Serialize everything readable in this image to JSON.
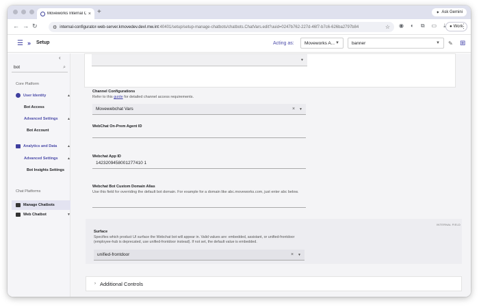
{
  "browser": {
    "tab_title": "Moveworks Internal Configura",
    "new_tab_label": "+",
    "gemini_label": "Ask Gemini",
    "url_host": "internal-configurator-web-server.kmovedev.devl.mw.int",
    "url_path": ":40401/setup/setup-manage-chatbots/chatbots.ChatVars.edit?uuid=0247b762-227d-46f7-b7c6-626ba2797b84",
    "profile_label": "Work"
  },
  "header": {
    "title": "Setup",
    "acting_as_label": "Acting as:",
    "acting_as_value": "Moveworks A...",
    "org_value": "banner"
  },
  "sidebar": {
    "collapse_label": "‹",
    "search_value": "bot",
    "sections": [
      "Core Platform",
      "Chat Platforms"
    ],
    "items": [
      {
        "label": "User Identity"
      },
      {
        "label": "Bot Access"
      },
      {
        "label": "Advanced Settings"
      },
      {
        "label": "Bot Account"
      },
      {
        "label": "Analytics and Data"
      },
      {
        "label": "Advanced Settings"
      },
      {
        "label": "Bot Insights Settings"
      },
      {
        "label": "Manage Chatbots"
      },
      {
        "label": "Web Chatbot"
      }
    ]
  },
  "main": {
    "channel_configurations": {
      "label": "Channel Configurations",
      "help_prefix": "Refer to this",
      "help_link": "guide",
      "help_suffix": "for detailed channel access requirements.",
      "value": "Movewebchat Vars"
    },
    "onprem_agent_id": {
      "label": "WebChat On-Prem Agent ID",
      "value": ""
    },
    "webchat_app_id": {
      "label": "Webchat App ID",
      "value": "1423209458001277410 1"
    },
    "custom_domain_alias": {
      "label": "Webchat Bot Custom Domain Alias",
      "help": "Use this field for overriding the default bot domain. For example for a domain like abc.moveworks.com, just enter abc below.",
      "value": ""
    },
    "surface": {
      "tag": "INTERNAL FIELD",
      "label": "Surface",
      "help": "Specifies which product UI surface the Webchat bot will appear in. Valid values are: embedded, assistant, or unified-frontdoor (employee-hub is deprecated, use unified-frontdoor instead). If not set, the default value is embedded.",
      "value": "unified-frontdoor"
    },
    "additional_controls": {
      "label": "Additional Controls"
    }
  },
  "colors": {
    "accent": "#3f3fa8",
    "sidebar_bg": "#f5f5f8",
    "main_bg": "#f4f4f6"
  }
}
